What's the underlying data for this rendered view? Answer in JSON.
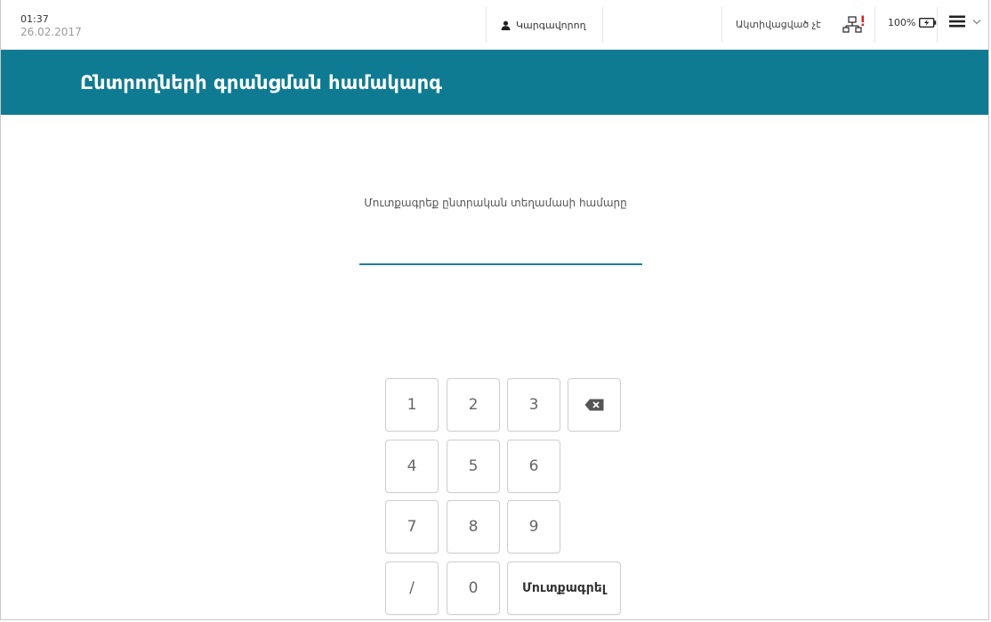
{
  "status": {
    "time": "01:37",
    "date": "26.02.2017",
    "operator_label": "Կարգավորող",
    "activation_status": "Ակտիվացված չէ",
    "battery_percent": "100%",
    "network_alert_color": "#d9261c"
  },
  "header": {
    "title": "Ընտրողների գրանցման համակարգ",
    "background": "#0f7b92"
  },
  "form": {
    "prompt": "Մուտքագրեք ընտրական տեղամասի համարը",
    "value": ""
  },
  "keypad": {
    "k1": "1",
    "k2": "2",
    "k3": "3",
    "k4": "4",
    "k5": "5",
    "k6": "6",
    "k7": "7",
    "k8": "8",
    "k9": "9",
    "slash": "/",
    "k0": "0",
    "enter": "Մուտքագրել"
  }
}
